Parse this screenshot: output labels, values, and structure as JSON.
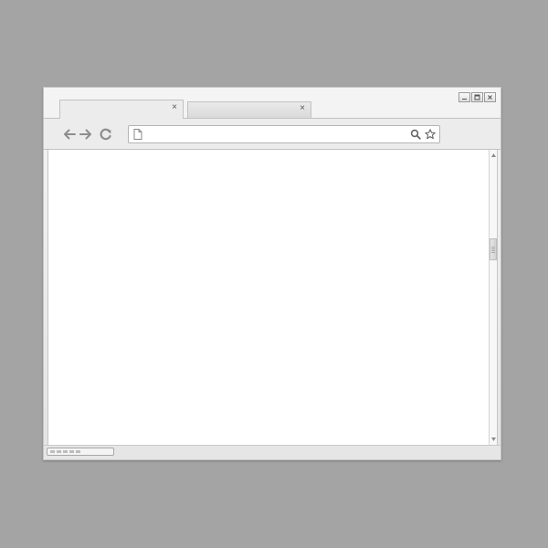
{
  "window": {
    "controls": [
      {
        "name": "minimize",
        "icon": "minimize-icon"
      },
      {
        "name": "maximize",
        "icon": "maximize-icon"
      },
      {
        "name": "close",
        "icon": "close-icon"
      }
    ]
  },
  "tabs": [
    {
      "title": "",
      "close_glyph": "×",
      "active": true
    },
    {
      "title": "",
      "close_glyph": "×",
      "active": false
    }
  ],
  "toolbar": {
    "back_icon": "arrow-left-icon",
    "forward_icon": "arrow-right-icon",
    "reload_icon": "reload-icon"
  },
  "address_bar": {
    "value": "",
    "placeholder": "",
    "page_icon": "page-icon",
    "search_icon": "search-icon",
    "bookmark_icon": "star-icon"
  },
  "statusbar": {
    "progress_segments": 5
  },
  "colors": {
    "desktop": "#a4a4a4",
    "chrome": "#ececec",
    "content": "#ffffff"
  }
}
